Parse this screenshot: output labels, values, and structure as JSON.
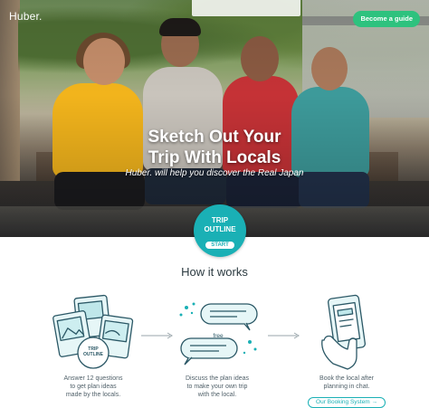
{
  "header": {
    "logo": "Huber.",
    "guide_button": "Become a guide"
  },
  "hero": {
    "title_line1": "Sketch Out Your",
    "title_line2": "Trip With Locals",
    "subtitle": "Huber. will help you discover the Real Japan"
  },
  "cta": {
    "line1": "TRIP",
    "line2": "OUTLINE",
    "start": "START"
  },
  "how_it_works": {
    "title": "How it works",
    "steps": [
      {
        "icon": "plan-cards-icon",
        "badge_line1": "TRIP",
        "badge_line2": "OUTLINE",
        "lines": [
          "Answer 12 questions",
          "to get plan ideas",
          "made by the locals."
        ]
      },
      {
        "icon": "chat-bubbles-icon",
        "badge": "free",
        "lines": [
          "Discuss the plan ideas",
          "to make your own trip",
          "with the local."
        ]
      },
      {
        "icon": "phone-booking-icon",
        "lines": [
          "Book the local after",
          "planning in chat."
        ]
      }
    ],
    "booking_link": "Our Booking System →"
  },
  "colors": {
    "accent": "#1ab0b5",
    "guide_button": "#2ec27e",
    "text": "#2b3a40"
  }
}
